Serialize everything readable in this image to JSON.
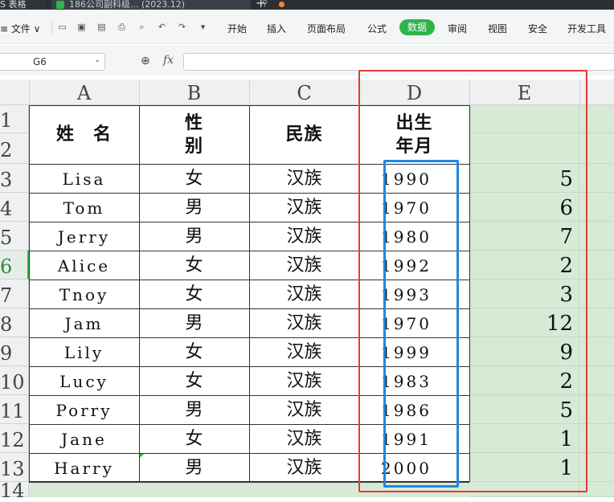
{
  "tabs": {
    "doc_label": "S 表格",
    "file_label": "186公司副科级... (2023.12)",
    "add_label": "+"
  },
  "menu": {
    "file": "≡ 文件 ∨",
    "items": [
      "开始",
      "插入",
      "页面布局",
      "公式",
      "数据",
      "审阅",
      "视图",
      "安全",
      "开发工具"
    ],
    "active": "数据"
  },
  "formula_bar": {
    "cell_ref": "G6",
    "fx_label": "fx",
    "formula": ""
  },
  "columns": [
    "A",
    "B",
    "C",
    "D",
    "E"
  ],
  "rows": [
    "1",
    "2",
    "3",
    "4",
    "5",
    "6",
    "7",
    "8",
    "9",
    "10",
    "11",
    "12",
    "13",
    "14"
  ],
  "selected_row": "6",
  "table_header": {
    "name": "姓　名",
    "gender": "性\n别",
    "ethnicity": "民族",
    "birth": "出生\n年月"
  },
  "records": [
    {
      "name": "Lisa",
      "gender": "女",
      "ethnicity": "汉族",
      "year": "1990",
      "e": "5"
    },
    {
      "name": "Tom",
      "gender": "男",
      "ethnicity": "汉族",
      "year": "1970",
      "e": "6"
    },
    {
      "name": "Jerry",
      "gender": "男",
      "ethnicity": "汉族",
      "year": "1980",
      "e": "7"
    },
    {
      "name": "Alice",
      "gender": "女",
      "ethnicity": "汉族",
      "year": "1992",
      "e": "2"
    },
    {
      "name": "Tnoy",
      "gender": "女",
      "ethnicity": "汉族",
      "year": "1993",
      "e": "3"
    },
    {
      "name": "Jam",
      "gender": "男",
      "ethnicity": "汉族",
      "year": "1970",
      "e": "12"
    },
    {
      "name": "Lily",
      "gender": "女",
      "ethnicity": "汉族",
      "year": "1999",
      "e": "9"
    },
    {
      "name": "Lucy",
      "gender": "女",
      "ethnicity": "汉族",
      "year": "1983",
      "e": "2"
    },
    {
      "name": "Porry",
      "gender": "男",
      "ethnicity": "汉族",
      "year": "1986",
      "e": "5"
    },
    {
      "name": "Jane",
      "gender": "女",
      "ethnicity": "汉族",
      "year": "1991",
      "e": "1"
    },
    {
      "name": "Harry",
      "gender": "男",
      "ethnicity": "汉族",
      "year": "2000",
      "e": "1"
    }
  ],
  "colors": {
    "accent": "#2fb34a",
    "selected_area_fill": "#d6ead6",
    "red_highlight": "#e53935",
    "blue_highlight": "#1e88e5"
  }
}
